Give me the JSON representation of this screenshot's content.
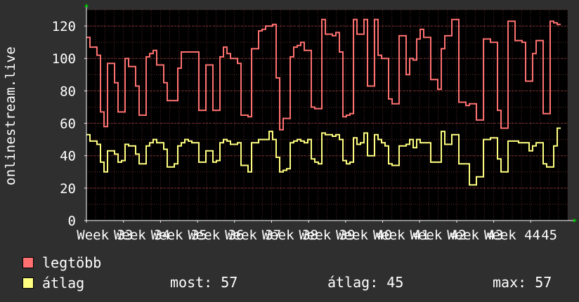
{
  "chart_data": {
    "type": "line",
    "ylabel": "onlinestream.live",
    "ylim": [
      0,
      130
    ],
    "yticks": [
      0,
      20,
      40,
      60,
      80,
      100,
      120
    ],
    "categories": [
      "Week 33",
      "Week 34",
      "Week 35",
      "Week 36",
      "Week 37",
      "Week 38",
      "Week 39",
      "Week 40",
      "Week 41",
      "Week 42",
      "Week 43",
      "Week 44",
      "Week 45"
    ],
    "tick_labels": [
      "Week 33",
      "Week 34",
      "Week 35",
      "Week 36",
      "Week 37",
      "Week 38",
      "Week 39",
      "Week 40",
      "Week 41",
      "Week 42",
      "Week 43",
      "Week 44",
      "45"
    ],
    "grid": true,
    "series": [
      {
        "name": "legtöbb",
        "color": "#ff7070",
        "values": [
          113,
          107,
          107,
          102,
          67,
          58,
          97,
          97,
          85,
          67,
          67,
          100,
          95,
          95,
          83,
          65,
          65,
          101,
          103,
          105,
          96,
          96,
          85,
          74,
          74,
          74,
          94,
          104,
          104,
          104,
          104,
          104,
          68,
          68,
          96,
          96,
          68,
          68,
          101,
          107,
          103,
          100,
          100,
          97,
          65,
          65,
          64,
          106,
          106,
          117,
          118,
          120,
          120,
          121,
          88,
          56,
          63,
          63,
          101,
          107,
          108,
          110,
          105,
          105,
          70,
          69,
          69,
          124,
          115,
          115,
          114,
          116,
          104,
          64,
          65,
          66,
          124,
          115,
          115,
          124,
          83,
          83,
          124,
          102,
          100,
          100,
          75,
          72,
          72,
          114,
          114,
          90,
          100,
          99,
          112,
          118,
          113,
          113,
          87,
          87,
          81,
          106,
          114,
          114,
          124,
          124,
          73,
          73,
          71,
          72,
          72,
          62,
          62,
          112,
          112,
          110,
          110,
          68,
          57,
          57,
          123,
          123,
          111,
          111,
          110,
          86,
          86,
          103,
          111,
          111,
          66,
          66,
          123,
          122,
          121
        ]
      },
      {
        "name": "átlag",
        "color": "#ffff80",
        "values": [
          53,
          49,
          49,
          47,
          36,
          30,
          43,
          43,
          41,
          36,
          37,
          47,
          46,
          46,
          41,
          35,
          35,
          46,
          48,
          50,
          48,
          48,
          44,
          33,
          33,
          35,
          46,
          48,
          50,
          49,
          48,
          48,
          36,
          36,
          43,
          43,
          36,
          37,
          48,
          50,
          49,
          47,
          47,
          48,
          34,
          34,
          30,
          48,
          48,
          50,
          50,
          50,
          55,
          50,
          39,
          30,
          31,
          32,
          48,
          49,
          50,
          49,
          48,
          50,
          38,
          36,
          35,
          54,
          53,
          53,
          52,
          53,
          50,
          37,
          35,
          36,
          51,
          47,
          48,
          54,
          40,
          40,
          53,
          50,
          48,
          46,
          35,
          34,
          34,
          46,
          46,
          47,
          50,
          45,
          50,
          48,
          48,
          48,
          36,
          36,
          36,
          55,
          47,
          47,
          53,
          53,
          35,
          35,
          35,
          22,
          22,
          27,
          27,
          50,
          50,
          51,
          51,
          38,
          30,
          30,
          49,
          49,
          49,
          48,
          48,
          48,
          43,
          46,
          48,
          48,
          35,
          33,
          33,
          46,
          57
        ]
      }
    ]
  },
  "legend": {
    "max_label": "legtöbb",
    "max_color": "#ff7070",
    "avg_label": "átlag",
    "avg_color": "#ffff80",
    "now_label": "most:",
    "now_value": "57",
    "avg_stat_label": "átlag:",
    "avg_stat_value": "45",
    "max_stat_label": "max:",
    "max_stat_value": "57"
  },
  "colors": {
    "background": "#2f2f2f",
    "plot_background": "#000000",
    "grid": "#5a2a2a",
    "axis": "#ffffff",
    "arrow": "#00c000"
  }
}
